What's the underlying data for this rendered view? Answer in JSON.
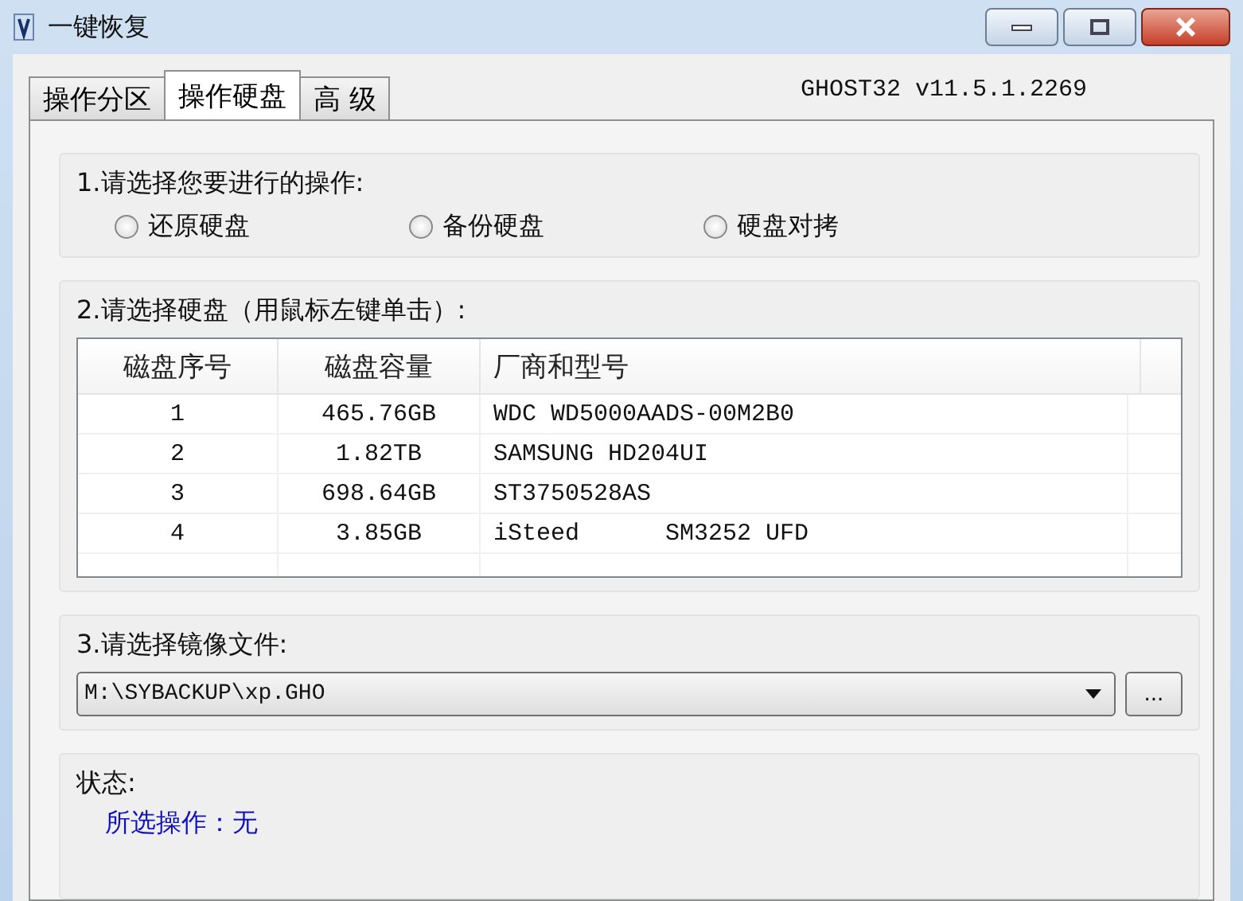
{
  "window": {
    "title": "一键恢复"
  },
  "tabs": [
    {
      "label": "操作分区",
      "selected": false
    },
    {
      "label": "操作硬盘",
      "selected": true
    },
    {
      "label": "高 级",
      "selected": false
    }
  ],
  "version": "GHOST32 v11.5.1.2269",
  "operation": {
    "label": "1.请选择您要进行的操作:",
    "options": [
      {
        "label": "还原硬盘",
        "selected": false
      },
      {
        "label": "备份硬盘",
        "selected": false
      },
      {
        "label": "硬盘对拷",
        "selected": false
      }
    ]
  },
  "disks": {
    "label": "2.请选择硬盘（用鼠标左键单击）:",
    "columns": [
      "磁盘序号",
      "磁盘容量",
      "厂商和型号"
    ],
    "rows": [
      {
        "cells": [
          "1",
          "465.76GB",
          "WDC WD5000AADS-00M2B0"
        ],
        "selected": false
      },
      {
        "cells": [
          "2",
          "1.82TB",
          "SAMSUNG HD204UI"
        ],
        "selected": false
      },
      {
        "cells": [
          "3",
          "698.64GB",
          "ST3750528AS"
        ],
        "selected": false
      },
      {
        "cells": [
          "4",
          "3.85GB",
          "iSteed      SM3252 UFD"
        ],
        "selected": false
      }
    ]
  },
  "image_file": {
    "label": "3.请选择镜像文件:",
    "value": "M:\\SYBACKUP\\xp.GHO",
    "browse": "..."
  },
  "status": {
    "label": "状态:",
    "lines": [
      "所选操作：无"
    ]
  }
}
